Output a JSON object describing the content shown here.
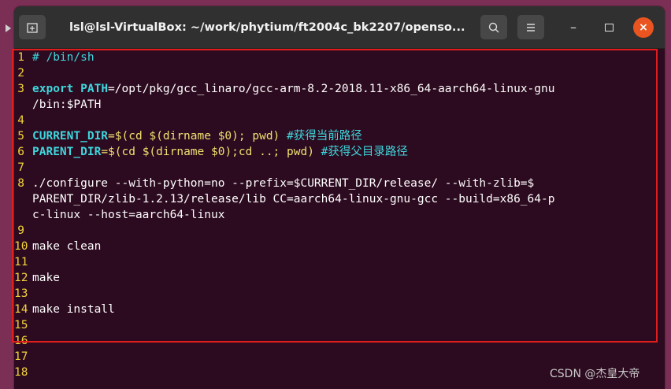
{
  "window": {
    "title": "lsl@lsl-VirtualBox: ~/work/phytium/ft2004c_bk2207/openso...",
    "new_tab_icon": "new-tab-icon",
    "search_icon": "search-icon",
    "menu_icon": "hamburger-menu-icon",
    "minimize_glyph": "–",
    "close_glyph": "×",
    "close_color": "#e95420"
  },
  "editor": {
    "line_numbers": [
      "1",
      "2",
      "3",
      "4",
      "5",
      "6",
      "7",
      "8",
      "9",
      "10",
      "11",
      "12",
      "13",
      "14",
      "15",
      "16",
      "17",
      "18"
    ],
    "lines": {
      "l1": "# /bin/sh",
      "l3_kw": "export",
      "l3_var": "PATH",
      "l3_rest": "=/opt/pkg/gcc_linaro/gcc-arm-8.2-2018.11-x86_64-aarch64-linux-gnu",
      "l3_wrap": "/bin:$PATH",
      "l5_var": "CURRENT_DIR",
      "l5_rest": "=$(cd $(dirname $0); pwd)",
      "l5_cmt": "#获得当前路径",
      "l6_var": "PARENT_DIR",
      "l6_rest": "=$(cd $(dirname $0);cd ..; pwd)",
      "l6_cmt": "#获得父目录路径",
      "l8": "./configure   --with-python=no --prefix=$CURRENT_DIR/release/  --with-zlib=$",
      "l8_wrap1": "PARENT_DIR/zlib-1.2.13/release/lib CC=aarch64-linux-gnu-gcc --build=x86_64-p",
      "l8_wrap2": "c-linux --host=aarch64-linux",
      "l10": "make clean",
      "l12": "make",
      "l14": "make install"
    }
  },
  "watermark": "CSDN @杰皇大帝"
}
